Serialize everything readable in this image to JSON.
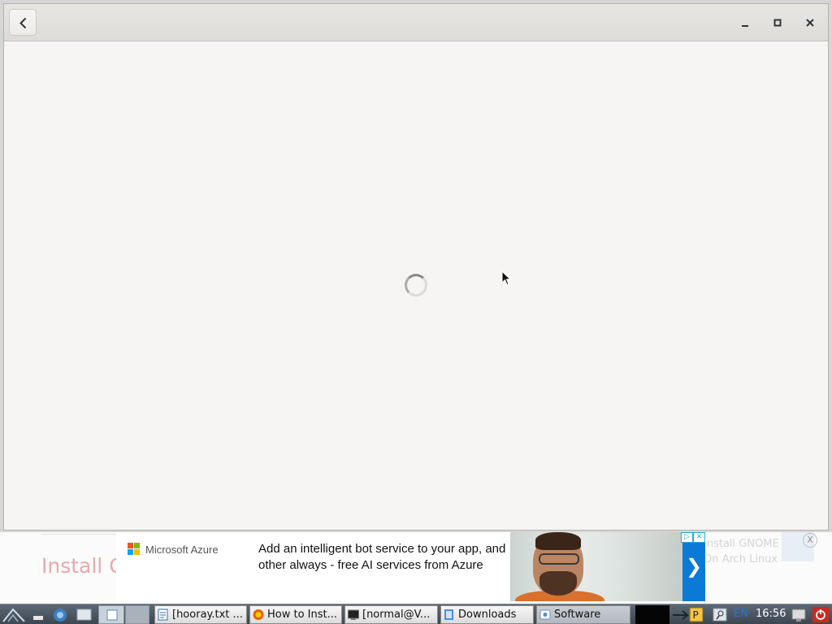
{
  "background_page": {
    "heading_fragment": "Install C",
    "right_text": "Install GNOME On Arch Linux",
    "close_glyph": "X"
  },
  "ad": {
    "brand": "Microsoft Azure",
    "text": "Add an intelligent bot service to your app, and other always - free AI services from Azure",
    "arrow": "❯",
    "choices_info": "▷",
    "choices_close": "✕"
  },
  "window": {
    "state": "loading"
  },
  "taskbar": {
    "tasks": [
      {
        "label": "[hooray.txt ..."
      },
      {
        "label": "How to Inst..."
      },
      {
        "label": "[normal@V..."
      },
      {
        "label": "Downloads"
      },
      {
        "label": "Software"
      }
    ],
    "language": "EN",
    "clock": "16:56"
  },
  "colors": {
    "accent": "#0a7ad6",
    "window_bg": "#f6f5f4",
    "taskbar": "#3d4751"
  }
}
